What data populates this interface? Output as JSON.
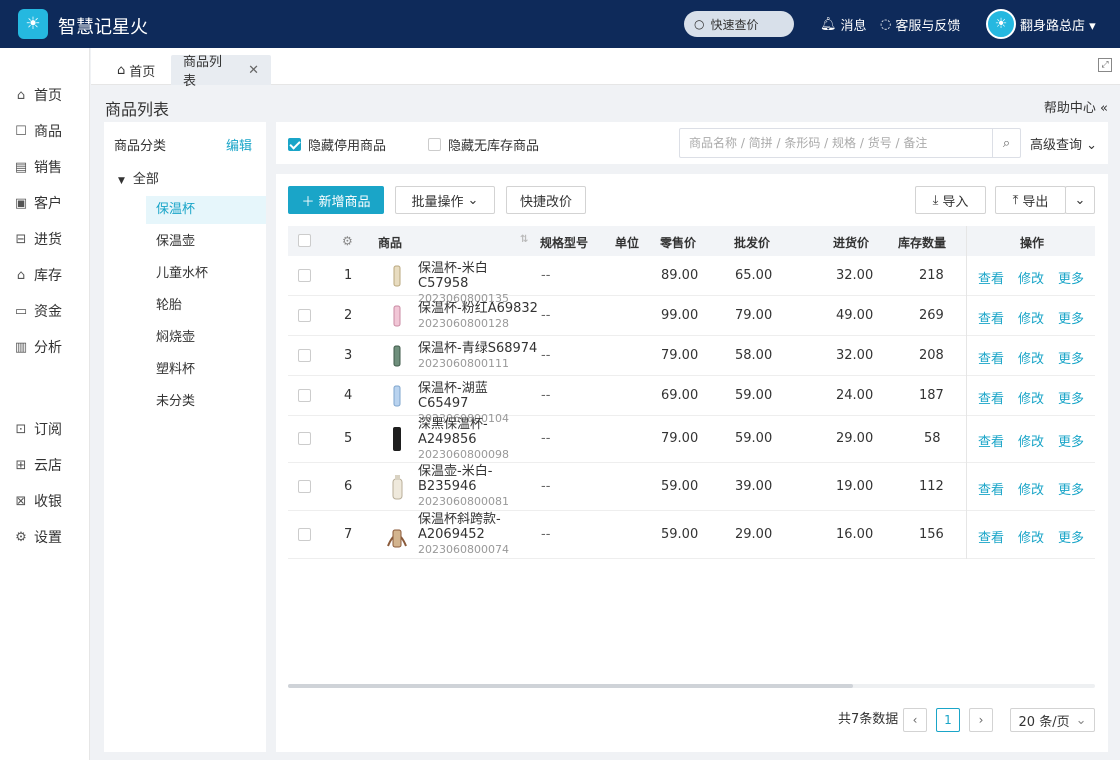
{
  "app": {
    "name": "智慧记星火"
  },
  "topbar": {
    "quick_search": "快速查价",
    "message": "消息",
    "service": "客服与反馈",
    "user": "翻身路总店"
  },
  "sidebar": {
    "items": [
      "首页",
      "商品",
      "销售",
      "客户",
      "进货",
      "库存",
      "资金",
      "分析"
    ],
    "items2": [
      "订阅",
      "云店",
      "收银",
      "设置"
    ]
  },
  "tabs": [
    {
      "label": "首页"
    },
    {
      "label": "商品列表"
    }
  ],
  "page": {
    "title": "商品列表",
    "help": "帮助中心"
  },
  "category": {
    "header": "商品分类",
    "edit": "编辑",
    "root": "全部",
    "items": [
      "保温杯",
      "保温壶",
      "儿童水杯",
      "轮胎",
      "焖烧壶",
      "塑料杯",
      "未分类"
    ],
    "selected": "保温杯"
  },
  "filters": {
    "hide_disabled": "隐藏停用商品",
    "hide_disabled_checked": true,
    "hide_nostock": "隐藏无库存商品",
    "hide_nostock_checked": false,
    "search_placeholder": "商品名称 / 简拼 / 条形码 / 规格 / 货号 / 备注",
    "advanced": "高级查询"
  },
  "toolbar": {
    "add": "新增商品",
    "batch": "批量操作",
    "quick_price": "快捷改价",
    "import": "导入",
    "export": "导出"
  },
  "table": {
    "headers": {
      "product": "商品",
      "spec": "规格型号",
      "unit": "单位",
      "retail": "零售价",
      "wholesale": "批发价",
      "cost": "进货价",
      "stock": "库存数量",
      "ops": "操作"
    },
    "rows": [
      {
        "idx": "1",
        "name": "保温杯-米白C57958",
        "code": "2023060800135",
        "spec": "--",
        "retail": "89.00",
        "wholesale": "65.00",
        "cost": "32.00",
        "stock": "218"
      },
      {
        "idx": "2",
        "name": "保温杯-粉红A69832",
        "code": "2023060800128",
        "spec": "--",
        "retail": "99.00",
        "wholesale": "79.00",
        "cost": "49.00",
        "stock": "269"
      },
      {
        "idx": "3",
        "name": "保温杯-青绿S68974",
        "code": "2023060800111",
        "spec": "--",
        "retail": "79.00",
        "wholesale": "58.00",
        "cost": "32.00",
        "stock": "208"
      },
      {
        "idx": "4",
        "name": "保温杯-湖蓝C65497",
        "code": "2023060800104",
        "spec": "--",
        "retail": "69.00",
        "wholesale": "59.00",
        "cost": "24.00",
        "stock": "187"
      },
      {
        "idx": "5",
        "name": "深黑保温杯-A249856",
        "code": "2023060800098",
        "spec": "--",
        "retail": "79.00",
        "wholesale": "59.00",
        "cost": "29.00",
        "stock": "58"
      },
      {
        "idx": "6",
        "name": "保温壶-米白-B235946",
        "code": "2023060800081",
        "spec": "--",
        "retail": "59.00",
        "wholesale": "39.00",
        "cost": "19.00",
        "stock": "112"
      },
      {
        "idx": "7",
        "name": "保温杯斜跨款-A2069452",
        "code": "2023060800074",
        "spec": "--",
        "retail": "59.00",
        "wholesale": "29.00",
        "cost": "16.00",
        "stock": "156"
      }
    ],
    "actions": {
      "view": "查看",
      "edit": "修改",
      "more": "更多"
    }
  },
  "pagination": {
    "total": "共7条数据",
    "current": "1",
    "page_size": "20 条/页"
  },
  "colors": {
    "accent": "#1aa5c8",
    "topbar": "#0e2a5a"
  }
}
